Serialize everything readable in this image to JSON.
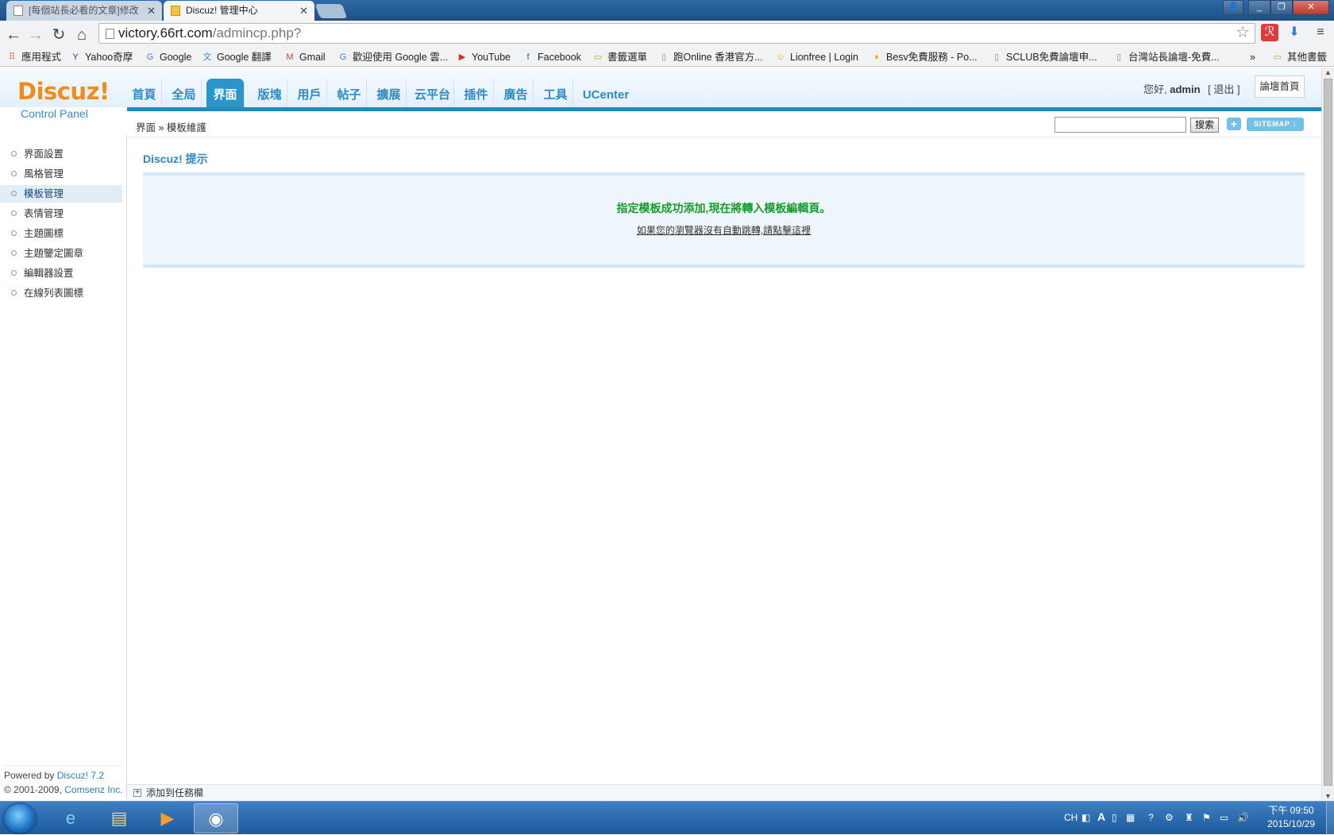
{
  "browser": {
    "tabs": [
      {
        "title": "[每個站長必看的文章]修改"
      },
      {
        "title": "Discuz! 管理中心"
      }
    ],
    "url_host": "victory.66rt.com",
    "url_path": "/admincp.php?",
    "bookmarks": [
      {
        "label": "應用程式",
        "icon": "apps-icon"
      },
      {
        "label": "Yahoo奇摩",
        "icon": "yahoo-icon"
      },
      {
        "label": "Google",
        "icon": "google-icon"
      },
      {
        "label": "Google 翻譯",
        "icon": "translate-icon"
      },
      {
        "label": "Gmail",
        "icon": "gmail-icon"
      },
      {
        "label": "歡迎使用 Google 雲...",
        "icon": "google-icon"
      },
      {
        "label": "YouTube",
        "icon": "youtube-icon"
      },
      {
        "label": "Facebook",
        "icon": "facebook-icon"
      },
      {
        "label": "書籤選單",
        "icon": "folder-icon"
      },
      {
        "label": "跑Online 香港官方...",
        "icon": "page-icon"
      },
      {
        "label": "Lionfree | Login",
        "icon": "lion-icon"
      },
      {
        "label": "Besv免費服務 - Po...",
        "icon": "besv-icon"
      },
      {
        "label": "SCLUB免費論壇申...",
        "icon": "page-icon"
      },
      {
        "label": "台灣站長論壇-免費...",
        "icon": "page-icon"
      }
    ],
    "bookmarks_more": "»",
    "other_bookmarks": "其他書籤"
  },
  "header": {
    "logo": "Discuz!",
    "logo_sub": "Control Panel",
    "nav": [
      "首頁",
      "全局",
      "界面",
      "版塊",
      "用戶",
      "帖子",
      "擴展",
      "云平台",
      "插件",
      "廣告",
      "工具",
      "UCenter"
    ],
    "active_nav": "界面",
    "greeting": "您好,",
    "username": "admin",
    "logout": "[ 退出 ]",
    "home_button": "論壇首頁"
  },
  "crumbbar": {
    "breadcrumb": "界面 » 模板維護",
    "search_button": "搜索",
    "plus_button": "+",
    "sitemap_button": "SITEMAP ↓"
  },
  "sidebar": {
    "items": [
      "界面設置",
      "風格管理",
      "模板管理",
      "表情管理",
      "主題圖標",
      "主題鑒定圖章",
      "編輯器設置",
      "在線列表圖標"
    ],
    "active_item": "模板管理",
    "powered_prefix": "Powered by",
    "powered_link": "Discuz! 7.2",
    "copyright_prefix": "© 2001-2009,",
    "copyright_link": "Comsenz Inc."
  },
  "content": {
    "tip_title": "Discuz! 提示",
    "message": "指定模板成功添加,現在將轉入模板編輯頁。",
    "redirect_link": "如果您的瀏覽器沒有自動跳轉,請點擊這裡",
    "add_to_taskbar": "添加到任務欄"
  },
  "taskbar": {
    "lang": "CH",
    "time": "下午 09:50",
    "date": "2015/10/29"
  },
  "colors": {
    "brand_orange": "#f08c1c",
    "nav_blue": "#2d8bc4",
    "success_green": "#179b2b"
  }
}
